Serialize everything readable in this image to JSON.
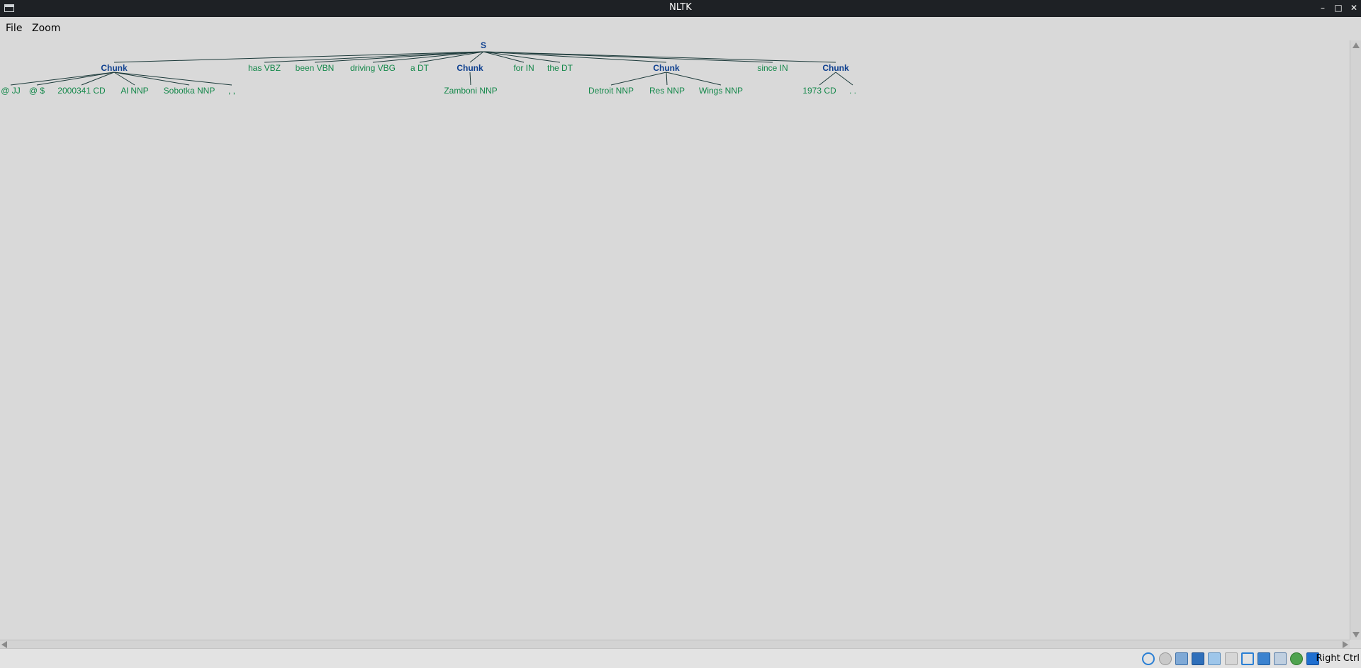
{
  "window": {
    "title": "NLTK"
  },
  "window_controls": {
    "minimize": "–",
    "maximize": "□",
    "close": "✕"
  },
  "menu": {
    "file": "File",
    "zoom": "Zoom"
  },
  "tree": {
    "root": "S",
    "children": [
      {
        "label": "Chunk",
        "leaves": [
          "@ JJ",
          "@ $",
          "2000341 CD",
          "Al NNP",
          "Sobotka NNP",
          ", ,"
        ]
      },
      {
        "leaf": "has VBZ"
      },
      {
        "leaf": "been VBN"
      },
      {
        "leaf": "driving VBG"
      },
      {
        "leaf": "a DT"
      },
      {
        "label": "Chunk",
        "leaves": [
          "Zamboni NNP"
        ]
      },
      {
        "leaf": "for IN"
      },
      {
        "leaf": "the DT"
      },
      {
        "label": "Chunk",
        "leaves": [
          "Detroit NNP",
          "Res NNP",
          "Wings NNP"
        ]
      },
      {
        "leaf": "since IN"
      },
      {
        "label": "Chunk",
        "leaves": [
          "1973 CD",
          ". ."
        ]
      }
    ]
  },
  "colors": {
    "node": "#0d3f8f",
    "leaf": "#14884a",
    "line": "#1c3a3a",
    "background": "#d9d9d9"
  },
  "statusbar": {
    "icons": [
      "hdd-icon",
      "optical-disk-icon",
      "audio-icon",
      "network-icon",
      "usb-icon",
      "shared-folder-icon",
      "display-icon",
      "recording-icon",
      "cpu-icon",
      "mouse-integration-icon",
      "keyboard-icon"
    ],
    "host_key": "Right Ctrl"
  }
}
